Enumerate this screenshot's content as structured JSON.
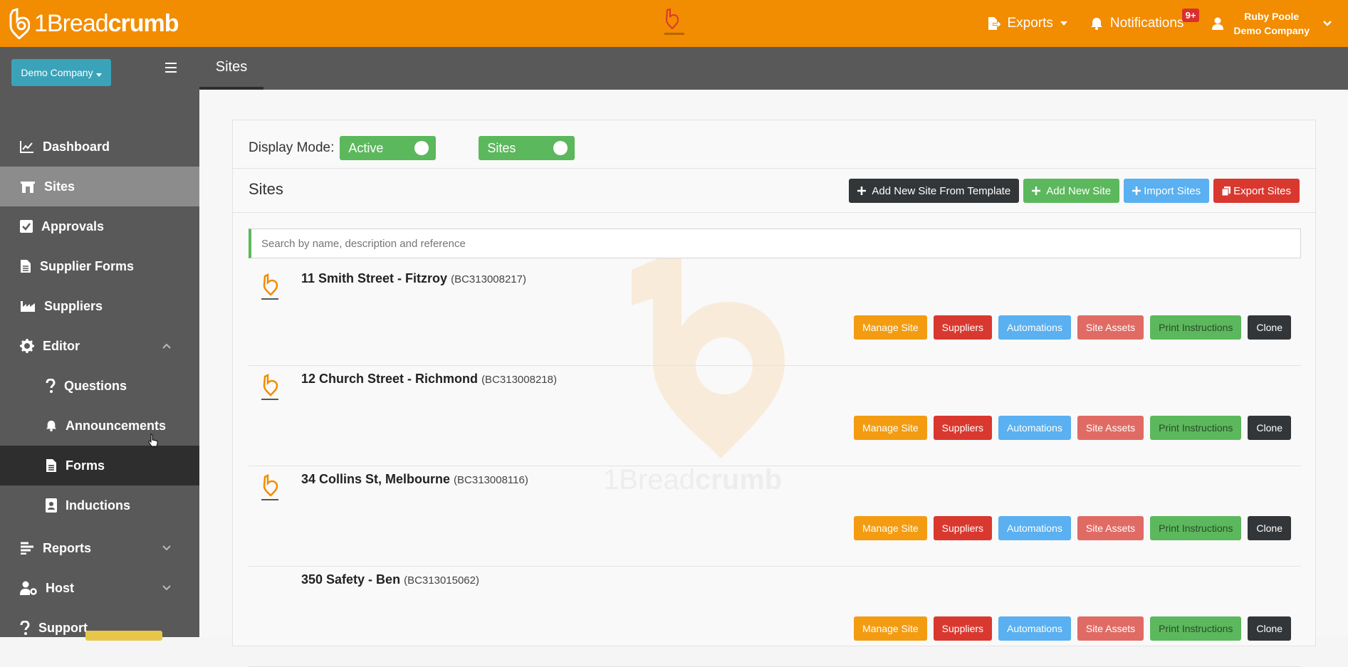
{
  "app": {
    "brand_light": "1Bread",
    "brand_bold": "crumb",
    "colors": {
      "accent": "#f28c00",
      "sidebar": "#595959",
      "active": "#8c8c8c"
    }
  },
  "header": {
    "exports_label": "Exports",
    "notifications_label": "Notifications",
    "notifications_badge": "9+",
    "user_name": "Ruby Poole",
    "user_company": "Demo Company"
  },
  "sidebar": {
    "company_select": "Demo Company",
    "items": [
      {
        "label": "Dashboard",
        "icon": "chart-line-icon"
      },
      {
        "label": "Sites",
        "icon": "building-icon",
        "active": true
      },
      {
        "label": "Approvals",
        "icon": "check-square-icon"
      },
      {
        "label": "Supplier Forms",
        "icon": "file-icon"
      },
      {
        "label": "Suppliers",
        "icon": "industry-icon"
      },
      {
        "label": "Editor",
        "icon": "gear-icon",
        "expanded": true
      },
      {
        "label": "Questions",
        "icon": "question-icon"
      },
      {
        "label": "Announcements",
        "icon": "bell-icon"
      },
      {
        "label": "Forms",
        "icon": "file-icon",
        "hover": true
      },
      {
        "label": "Inductions",
        "icon": "id-card-icon"
      },
      {
        "label": "Reports",
        "icon": "bars-icon"
      },
      {
        "label": "Host",
        "icon": "user-gear-icon"
      },
      {
        "label": "Support",
        "icon": "question-icon"
      }
    ]
  },
  "page": {
    "tab": "Sites",
    "display_mode_label": "Display Mode:",
    "toggle_active": "Active",
    "toggle_sites": "Sites",
    "section_title": "Sites",
    "actions": {
      "add_from_template": "Add New Site From Template",
      "add_new": "Add New Site",
      "import": "Import Sites",
      "export": "Export Sites"
    },
    "search_placeholder": "Search by name, description and reference"
  },
  "site_buttons": {
    "manage": "Manage Site",
    "suppliers": "Suppliers",
    "automations": "Automations",
    "assets": "Site Assets",
    "print": "Print Instructions",
    "clone": "Clone"
  },
  "sites": [
    {
      "name": "11 Smith Street - Fitzroy",
      "ref": "(BC313008217)",
      "has_logo": true
    },
    {
      "name": "12 Church Street - Richmond",
      "ref": "(BC313008218)",
      "has_logo": true
    },
    {
      "name": "34 Collins St, Melbourne",
      "ref": "(BC313008116)",
      "has_logo": true
    },
    {
      "name": "350 Safety - Ben",
      "ref": "(BC313015062)",
      "has_logo": false
    }
  ]
}
